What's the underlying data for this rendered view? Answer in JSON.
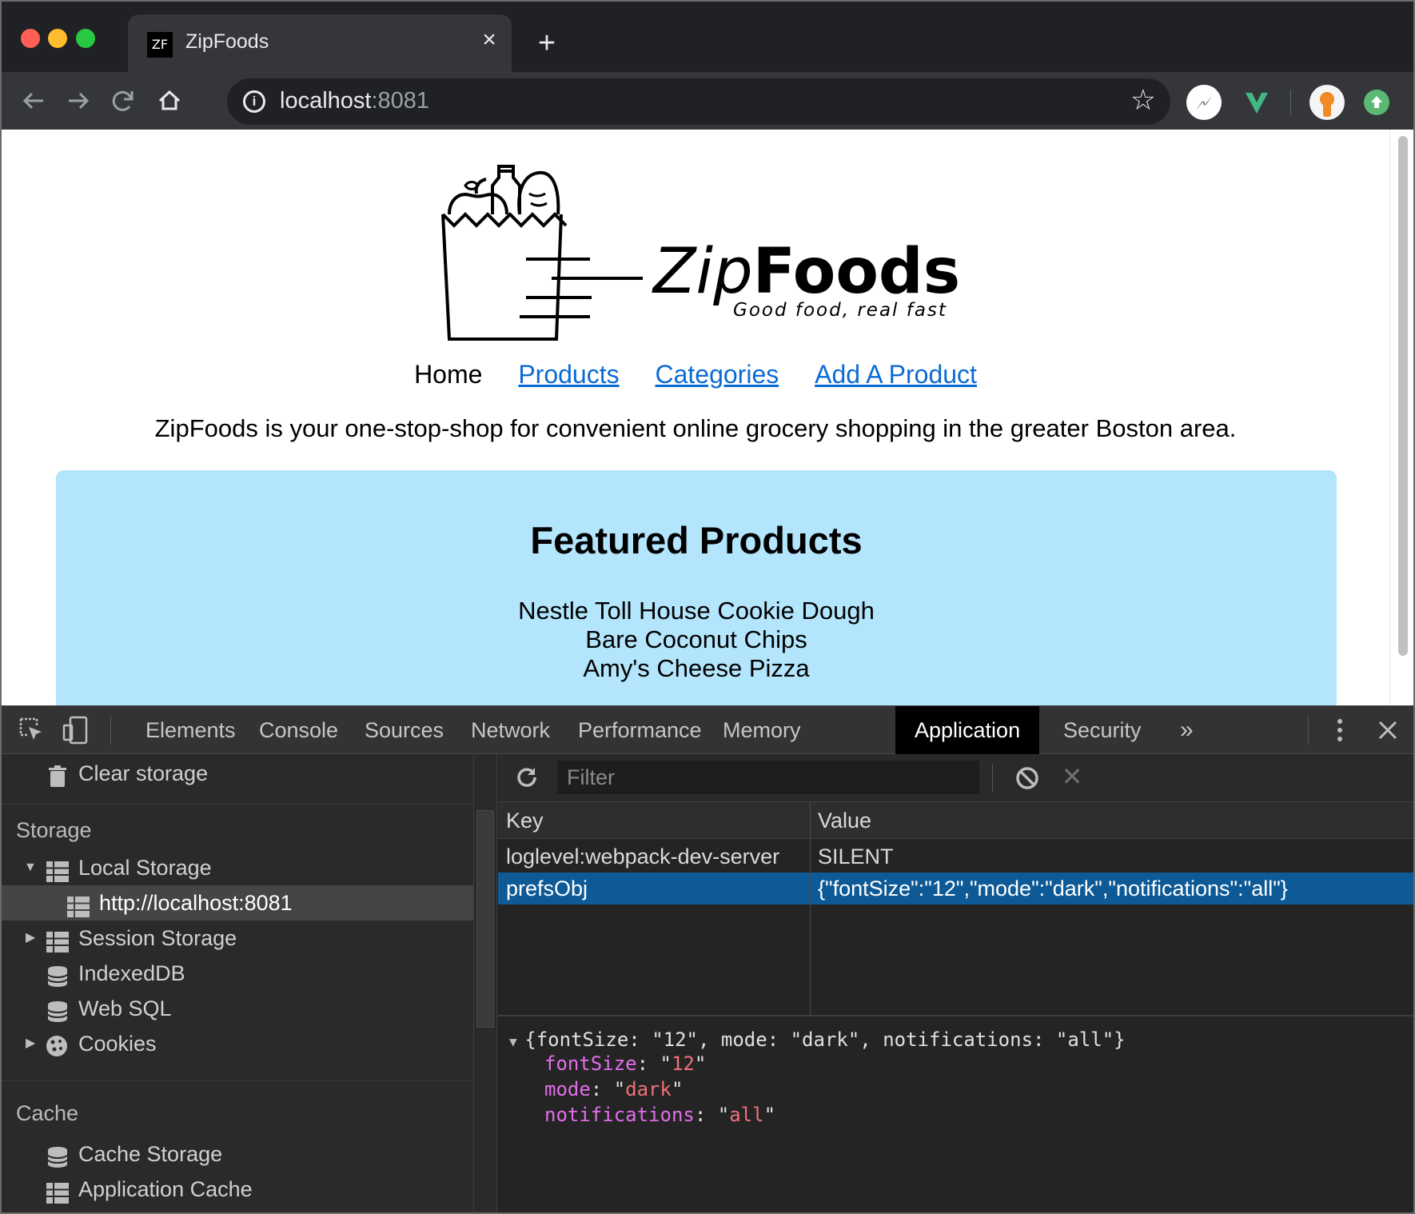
{
  "browser": {
    "tab_title": "ZipFoods",
    "favicon_text": "ZF",
    "url_host": "localhost",
    "url_port": ":8081",
    "colors": {
      "close": "#ff5f57",
      "minimize": "#febc2e",
      "maximize": "#28c840"
    }
  },
  "page": {
    "brand_zip": "Zip",
    "brand_foods": "Foods",
    "tagline": "Good food, real fast",
    "nav": {
      "home": "Home",
      "products": "Products",
      "categories": "Categories",
      "add_product": "Add A Product"
    },
    "intro": "ZipFoods is your one-stop-shop for convenient online grocery shopping in the greater Boston area.",
    "featured": {
      "heading": "Featured Products",
      "items": [
        "Nestle Toll House Cookie Dough",
        "Bare Coconut Chips",
        "Amy's Cheese Pizza"
      ]
    }
  },
  "devtools": {
    "tabs": [
      "Elements",
      "Console",
      "Sources",
      "Network",
      "Performance",
      "Memory",
      "Application",
      "Security"
    ],
    "active_tab": "Application",
    "sidebar": {
      "clear_storage": "Clear storage",
      "storage_header": "Storage",
      "local_storage": "Local Storage",
      "local_storage_origin": "http://localhost:8081",
      "session_storage": "Session Storage",
      "indexeddb": "IndexedDB",
      "websql": "Web SQL",
      "cookies": "Cookies",
      "cache_header": "Cache",
      "cache_storage": "Cache Storage",
      "application_cache": "Application Cache"
    },
    "filter_placeholder": "Filter",
    "table": {
      "headers": {
        "key": "Key",
        "value": "Value"
      },
      "rows": [
        {
          "key": "loglevel:webpack-dev-server",
          "value": "SILENT"
        },
        {
          "key": "prefsObj",
          "value": "{\"fontSize\":\"12\",\"mode\":\"dark\",\"notifications\":\"all\"}"
        }
      ]
    },
    "preview": {
      "summary": "{fontSize: \"12\", mode: \"dark\", notifications: \"all\"}",
      "props": [
        {
          "key": "fontSize",
          "value": "12"
        },
        {
          "key": "mode",
          "value": "dark"
        },
        {
          "key": "notifications",
          "value": "all"
        }
      ]
    }
  }
}
